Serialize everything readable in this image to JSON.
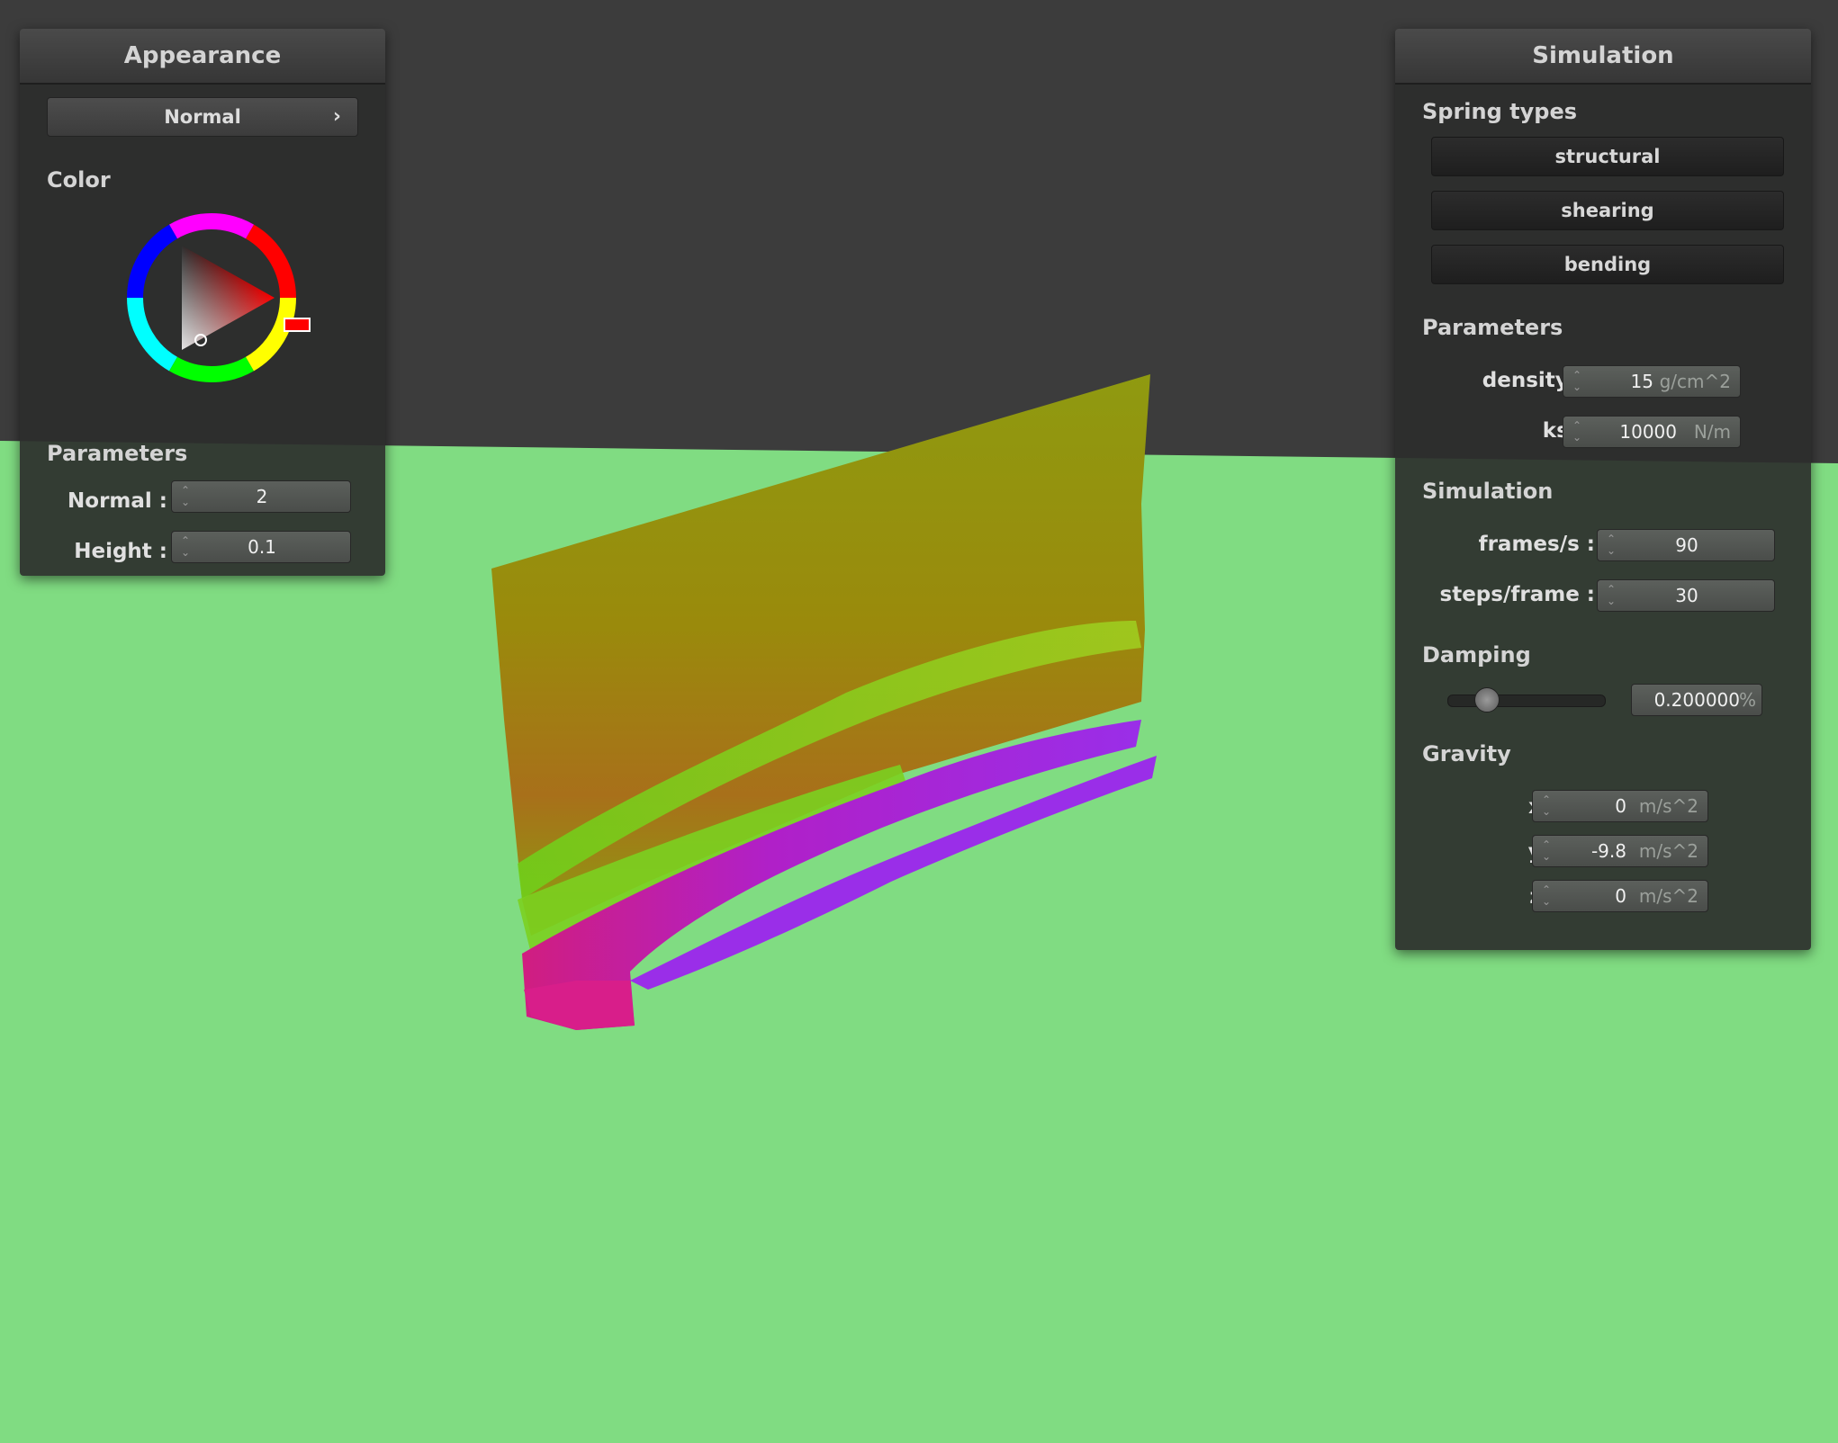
{
  "colors": {
    "floor": "#80dc82",
    "sky": "#3c3c3c",
    "panel_bg": "#2c2e2c",
    "cloth_top": "#8f9a08",
    "cloth_fold": "#c41fa0",
    "cloth_fold_blue": "#8a1fe0",
    "selected_color": "#ff0000"
  },
  "appearance": {
    "title": "Appearance",
    "shader_button": "Normal",
    "shader_chevron": "›",
    "color_label": "Color",
    "parameters_label": "Parameters",
    "normal_label": "Normal :",
    "normal_value": "2",
    "height_label": "Height :",
    "height_value": "0.1"
  },
  "simulation_panel": {
    "title": "Simulation",
    "spring_types_label": "Spring types",
    "spring_buttons": [
      "structural",
      "shearing",
      "bending"
    ],
    "parameters_label": "Parameters",
    "density_label": "density :",
    "density_value": "15",
    "density_unit": "g/cm^2",
    "ks_label": "ks :",
    "ks_value": "10000",
    "ks_unit": "N/m",
    "simulation_label": "Simulation",
    "fps_label": "frames/s :",
    "fps_value": "90",
    "steps_label": "steps/frame :",
    "steps_value": "30",
    "damping_label": "Damping",
    "damping_value": "0.200000",
    "damping_unit": "%",
    "damping_fraction": 0.2,
    "gravity_label": "Gravity",
    "gx_label": "x :",
    "gx_value": "0",
    "gy_label": "y :",
    "gy_value": "-9.8",
    "gz_label": "z :",
    "gz_value": "0",
    "gravity_unit": "m/s^2"
  }
}
